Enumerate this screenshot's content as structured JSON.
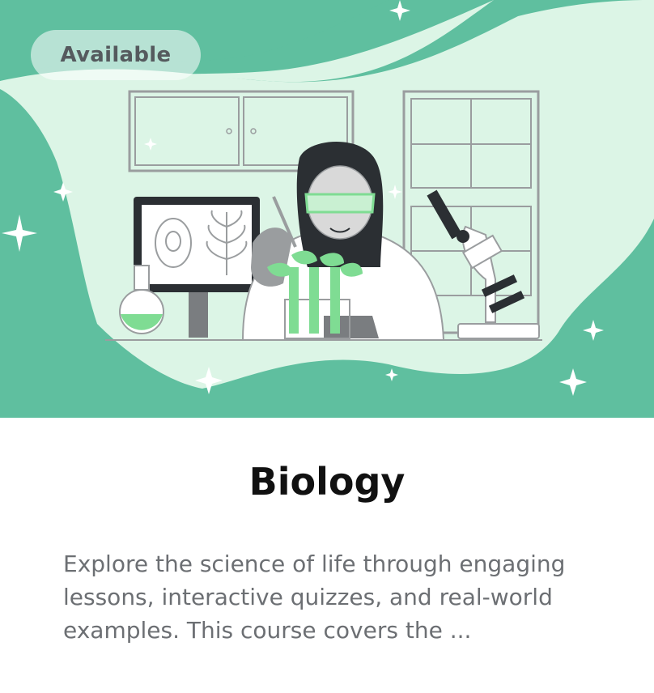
{
  "badge": {
    "label": "Available"
  },
  "course": {
    "title": "Biology",
    "description": "Explore the science of life through engaging lessons, interactive quizzes, and real-world examples. This course covers the ..."
  },
  "colors": {
    "hero_dark": "#5fbf9f",
    "hero_light": "#dcf5e6",
    "accent_green": "#7fdc93",
    "outline": "#2b2f33"
  },
  "illustration": {
    "icon": "scientist-lab-illustration"
  }
}
